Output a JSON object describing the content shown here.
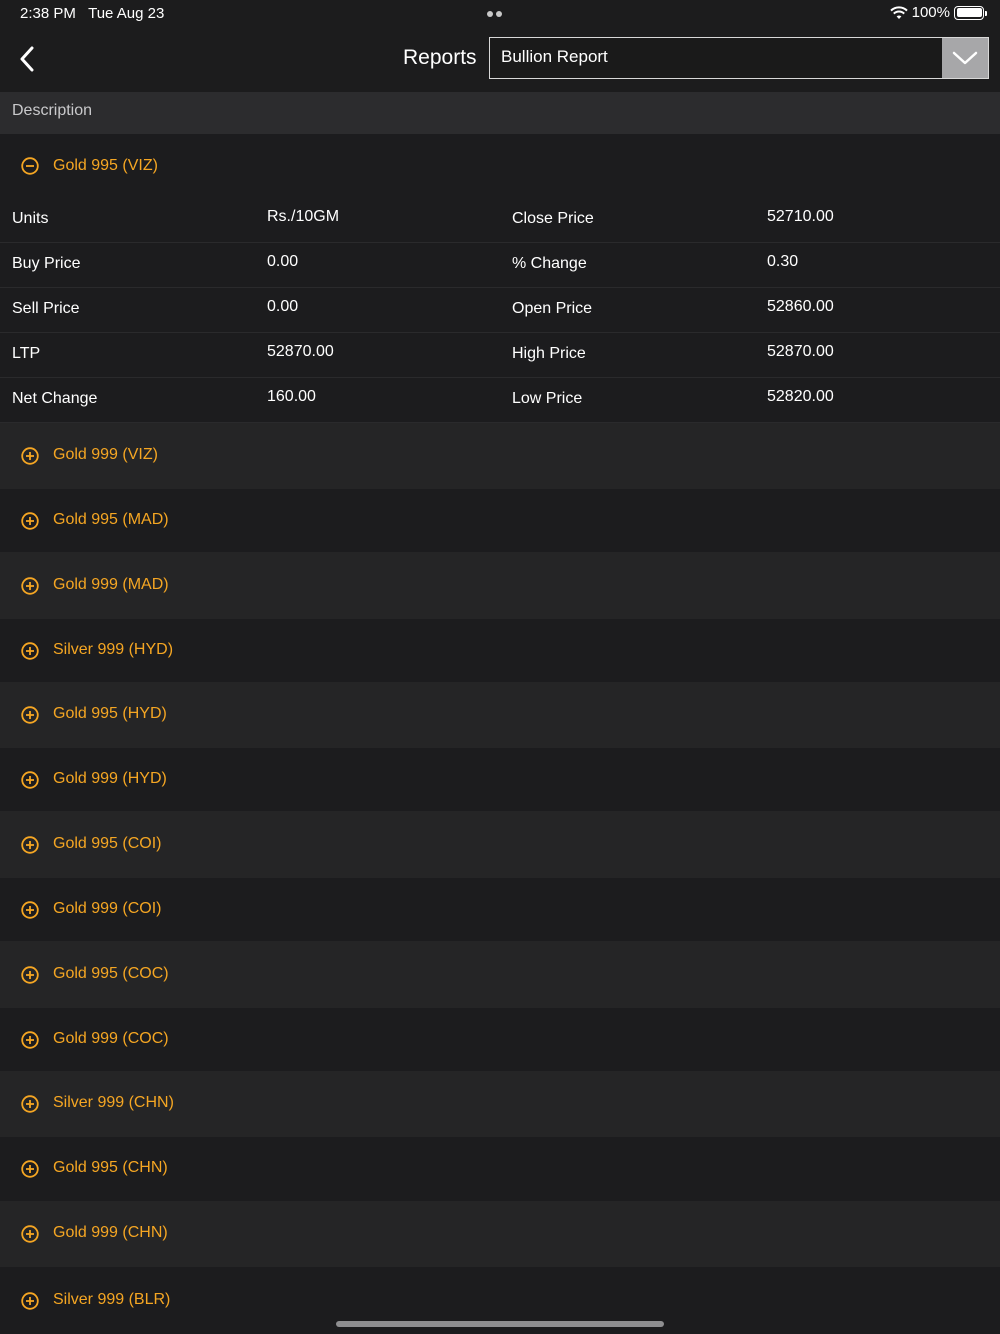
{
  "status": {
    "time": "2:38 PM",
    "date": "Tue Aug 23",
    "battery": "100%"
  },
  "nav": {
    "title": "Reports",
    "selected_report": "Bullion Report"
  },
  "list_header": "Description",
  "expanded": {
    "name": "Gold 995 (VIZ)",
    "rows": [
      {
        "l1": "Units",
        "v1": "Rs./10GM",
        "l2": "Close Price",
        "v2": "52710.00"
      },
      {
        "l1": "Buy Price",
        "v1": "0.00",
        "l2": "% Change",
        "v2": "0.30"
      },
      {
        "l1": "Sell Price",
        "v1": "0.00",
        "l2": "Open Price",
        "v2": "52860.00"
      },
      {
        "l1": "LTP",
        "v1": "52870.00",
        "l2": "High Price",
        "v2": "52870.00"
      },
      {
        "l1": "Net Change",
        "v1": "160.00",
        "l2": "Low Price",
        "v2": "52820.00"
      }
    ]
  },
  "collapsed": [
    "Gold 999 (VIZ)",
    "Gold 995 (MAD)",
    "Gold 999 (MAD)",
    "Silver 999 (HYD)",
    "Gold 995 (HYD)",
    "Gold 999 (HYD)",
    "Gold 995 (COI)",
    "Gold 999 (COI)",
    "Gold 995 (COC)",
    "Gold 999 (COC)",
    "Silver 999 (CHN)",
    "Gold 995 (CHN)",
    "Gold 999 (CHN)",
    "Silver 999 (BLR)"
  ],
  "colors": {
    "accent": "#f5a623",
    "background": "#1c1c1e",
    "row_alt": "#252526"
  }
}
